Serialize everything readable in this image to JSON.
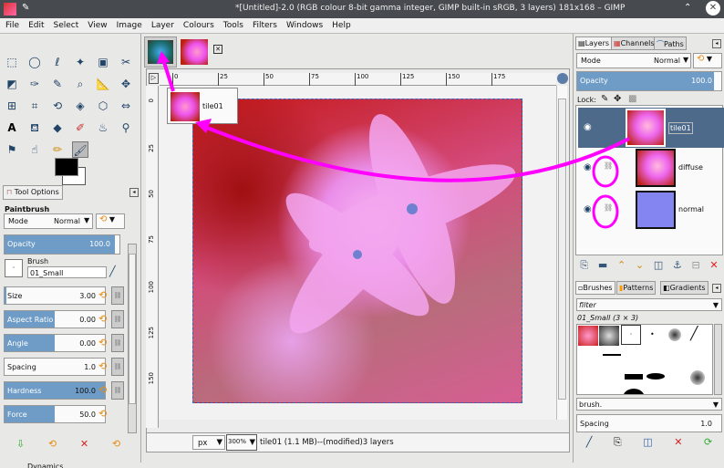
{
  "window": {
    "title": "*[Untitled]-2.0 (RGB colour 8-bit gamma integer, GIMP built-in sRGB, 3 layers) 181x168 – GIMP"
  },
  "menu": [
    "File",
    "Edit",
    "Select",
    "View",
    "Image",
    "Layer",
    "Colours",
    "Tools",
    "Filters",
    "Windows",
    "Help"
  ],
  "tool_options": {
    "tab": "Tool Options",
    "tool": "Paintbrush",
    "mode_label": "Mode",
    "mode_value": "Normal",
    "opacity_label": "Opacity",
    "opacity_value": "100.0",
    "opacity_fraction": 1.0,
    "brush_label": "Brush",
    "brush_value": "01_Small",
    "params": [
      {
        "label": "Size",
        "value": "3.00",
        "fill": "2%"
      },
      {
        "label": "Aspect Ratio",
        "value": "0.00",
        "fill": "50%"
      },
      {
        "label": "Angle",
        "value": "0.00",
        "fill": "50%"
      },
      {
        "label": "Spacing",
        "value": "1.0",
        "fill": "0%"
      },
      {
        "label": "Hardness",
        "value": "100.0",
        "fill": "100%"
      },
      {
        "label": "Force",
        "value": "50.0",
        "fill": "50%"
      }
    ],
    "dynamics_label": "Dynamics"
  },
  "canvas": {
    "ruler_ticks": [
      "0",
      "25",
      "50",
      "75",
      "100",
      "125",
      "150",
      "175"
    ],
    "vruler_ticks": [
      "0",
      "25",
      "50",
      "75",
      "100",
      "125",
      "150"
    ],
    "drag_label": "tile01"
  },
  "status": {
    "unit": "px",
    "zoom": "300%",
    "info": "tile01 (1.1 MB)--(modified)3 layers"
  },
  "layers": {
    "tabs": [
      "Layers",
      "Channels",
      "Paths"
    ],
    "mode_label": "Mode",
    "mode_value": "Normal",
    "opacity_label": "Opacity",
    "opacity_value": "100.0",
    "lock_label": "Lock:",
    "items": [
      {
        "name": "tile01",
        "selected": true
      },
      {
        "name": "diffuse"
      },
      {
        "name": "normal"
      }
    ]
  },
  "brushes": {
    "tabs": [
      "Brushes",
      "Patterns",
      "Gradients"
    ],
    "filter": "filter",
    "current": "01_Small (3 × 3)",
    "tag": "brush.",
    "spacing_label": "Spacing",
    "spacing_value": "1.0"
  },
  "colors": {
    "accent": "#6e9cc6",
    "annotation": "#ff00ff",
    "selected_row": "#4d6a8a"
  }
}
